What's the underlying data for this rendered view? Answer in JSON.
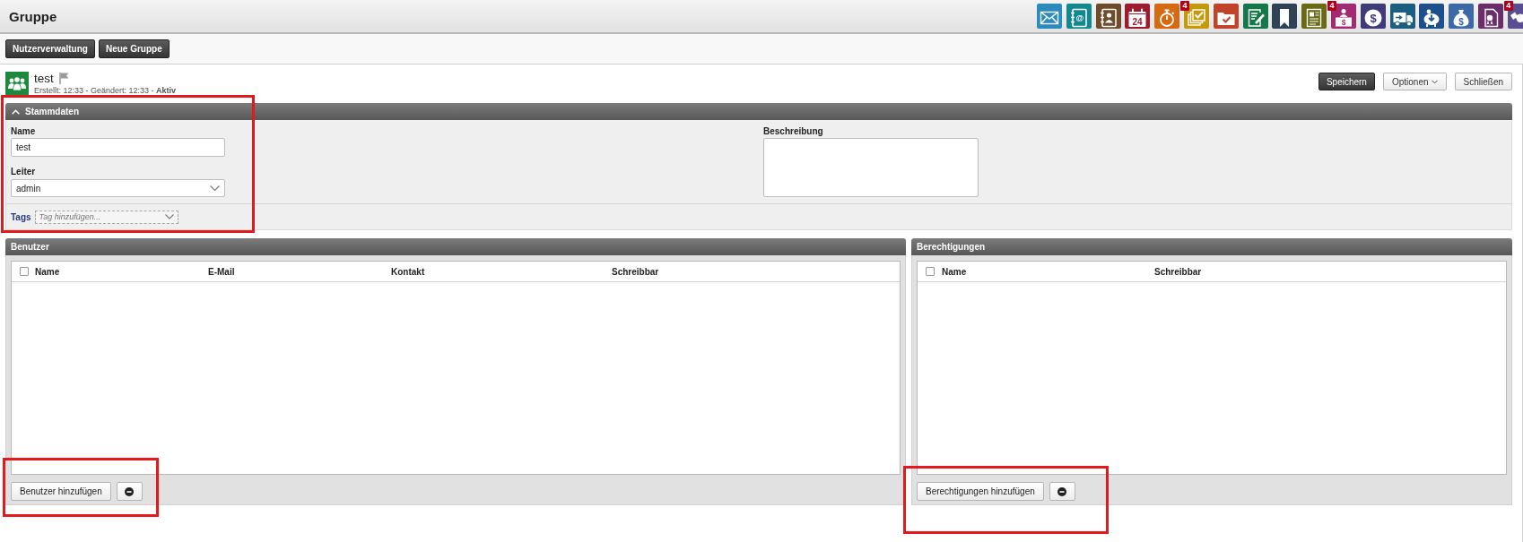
{
  "header": {
    "title": "Gruppe",
    "launcher": [
      {
        "kind": "envelope",
        "color": "#2b8bbd"
      },
      {
        "kind": "address-book",
        "color": "#12888f",
        "label": "@"
      },
      {
        "kind": "contact-book",
        "color": "#6e4b2b"
      },
      {
        "kind": "calendar",
        "color": "#9e1b2e",
        "label": "24"
      },
      {
        "kind": "stopwatch",
        "color": "#d66a10"
      },
      {
        "kind": "checklist",
        "color": "#c49a0a",
        "badge": "4"
      },
      {
        "kind": "folder-check",
        "color": "#c1442a"
      },
      {
        "kind": "document-edit",
        "color": "#16774a"
      },
      {
        "kind": "bookmark",
        "color": "#2f4256"
      },
      {
        "kind": "document",
        "color": "#6a6a16"
      },
      {
        "kind": "cashier",
        "color": "#a12a70",
        "label": "$",
        "badge": "4"
      },
      {
        "kind": "dollar-coin",
        "color": "#3f3b7a",
        "label": "$"
      },
      {
        "kind": "truck",
        "color": "#1b5e80"
      },
      {
        "kind": "piggy-bank",
        "color": "#1d4f8c"
      },
      {
        "kind": "money-bag",
        "color": "#3c6aa8",
        "label": "$"
      },
      {
        "kind": "certificate",
        "color": "#6a2e6a"
      },
      {
        "kind": "handshake",
        "color": "#5b4d92",
        "badge": "4"
      }
    ]
  },
  "toolbar": {
    "buttons": [
      "Nutzerverwaltung",
      "Neue Gruppe"
    ]
  },
  "record": {
    "title": "test",
    "flagged": false,
    "meta": "Erstellt: 12:33 - Geändert: 12:33 - **Aktiv**",
    "actions": [
      {
        "label": "Speichern",
        "kind": "primary"
      },
      {
        "label": "Optionen",
        "kind": "dropdown"
      },
      {
        "label": "Schließen",
        "kind": "plain"
      }
    ]
  },
  "stammdaten": {
    "title": "Stammdaten",
    "expanded": true,
    "highlighted": true,
    "fields": [
      {
        "label": "Name",
        "kind": "text",
        "value": "test"
      },
      {
        "label": "Leiter",
        "kind": "select",
        "value": "admin"
      }
    ],
    "description": {
      "label": "Beschreibung"
    },
    "tags": {
      "label": "Tags",
      "placeholder": "Tag hinzufügen..."
    }
  },
  "panels": [
    {
      "title": "Benutzer",
      "select_all_checked": false,
      "columns": [
        "Name",
        "E-Mail",
        "Kontakt",
        "Schreibbar"
      ],
      "add_button": "Benutzer hinzufügen",
      "highlighted": true
    },
    {
      "title": "Berechtigungen",
      "select_all_checked": false,
      "columns": [
        "Name",
        "Schreibbar"
      ],
      "add_button": "Berechtigungen hinzufügen",
      "highlighted": true
    }
  ]
}
